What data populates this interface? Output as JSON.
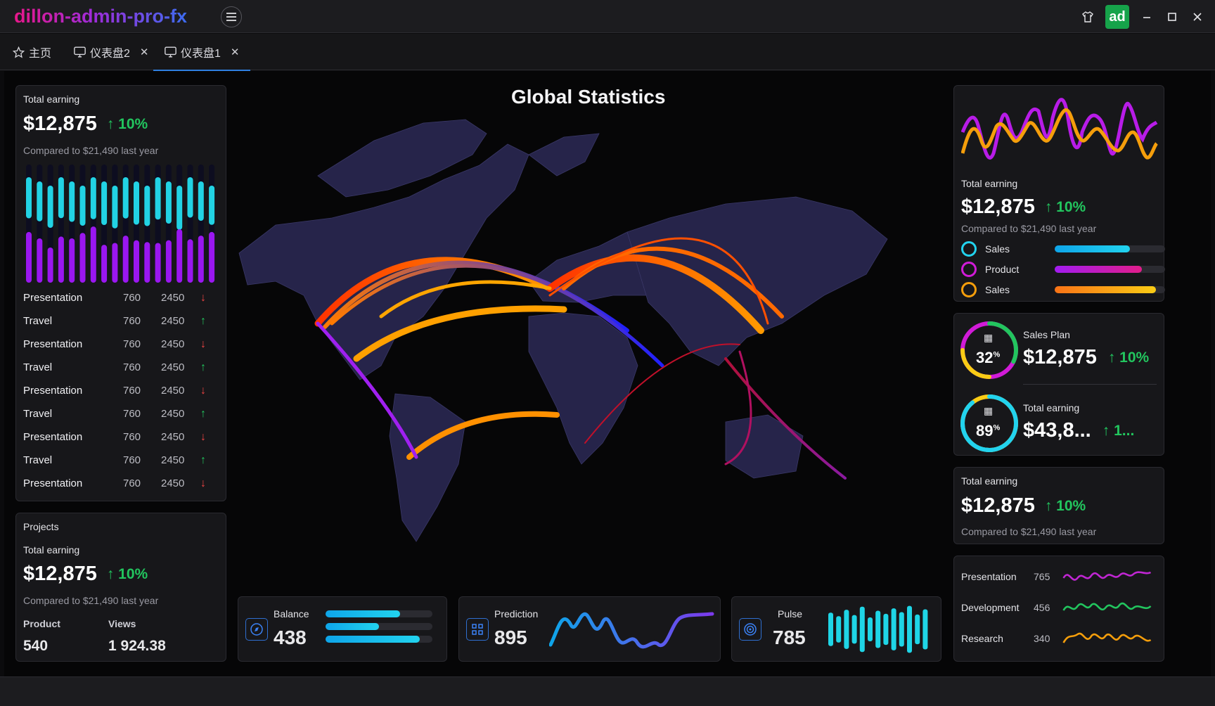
{
  "app": {
    "title": "dillon-admin-pro-fx",
    "avatar": "ad"
  },
  "tabs": [
    {
      "label": "主页",
      "icon": "star-icon",
      "closable": false
    },
    {
      "label": "仪表盘2",
      "icon": "monitor-icon",
      "closable": true
    },
    {
      "label": "仪表盘1",
      "icon": "monitor-icon",
      "closable": true,
      "active": true
    }
  ],
  "colors": {
    "accent": "#2f7fe0",
    "up": "#22c55e",
    "down": "#ef4444",
    "cyan": "#22d3ee",
    "purple": "#a21cf0",
    "orange": "#f59e0b",
    "magenta": "#d11bd8"
  },
  "earning_card": {
    "title": "Total earning",
    "amount": "$12,875",
    "pct": "10%",
    "compare": "Compared to $21,490 last year",
    "bars": [
      {
        "top": 0.74,
        "bottom": 0.57
      },
      {
        "top": 0.67,
        "bottom": 0.5
      },
      {
        "top": 0.8,
        "bottom": 0.4
      },
      {
        "top": 0.73,
        "bottom": 0.52
      },
      {
        "top": 0.7,
        "bottom": 0.5
      },
      {
        "top": 0.68,
        "bottom": 0.56
      },
      {
        "top": 0.79,
        "bottom": 0.63
      },
      {
        "top": 0.88,
        "bottom": 0.43
      },
      {
        "top": 0.83,
        "bottom": 0.45
      },
      {
        "top": 0.75,
        "bottom": 0.53
      },
      {
        "top": 0.86,
        "bottom": 0.48
      },
      {
        "top": 0.7,
        "bottom": 0.46
      },
      {
        "top": 0.81,
        "bottom": 0.45
      },
      {
        "top": 0.8,
        "bottom": 0.48
      },
      {
        "top": 0.91,
        "bottom": 0.6
      },
      {
        "top": 0.7,
        "bottom": 0.49
      },
      {
        "top": 0.64,
        "bottom": 0.53
      },
      {
        "top": 0.63,
        "bottom": 0.57
      }
    ]
  },
  "list": [
    {
      "name": "Presentation",
      "v1": "760",
      "v2": "2450",
      "dir": "down"
    },
    {
      "name": "Travel",
      "v1": "760",
      "v2": "2450",
      "dir": "up"
    },
    {
      "name": "Presentation",
      "v1": "760",
      "v2": "2450",
      "dir": "down"
    },
    {
      "name": "Travel",
      "v1": "760",
      "v2": "2450",
      "dir": "up"
    },
    {
      "name": "Presentation",
      "v1": "760",
      "v2": "2450",
      "dir": "down"
    },
    {
      "name": "Travel",
      "v1": "760",
      "v2": "2450",
      "dir": "up"
    },
    {
      "name": "Presentation",
      "v1": "760",
      "v2": "2450",
      "dir": "down"
    },
    {
      "name": "Travel",
      "v1": "760",
      "v2": "2450",
      "dir": "up"
    },
    {
      "name": "Presentation",
      "v1": "760",
      "v2": "2450",
      "dir": "down"
    }
  ],
  "projects": {
    "title": "Projects",
    "subtitle": "Total earning",
    "amount": "$12,875",
    "pct": "10%",
    "compare": "Compared to $21,490 last year",
    "col1_label": "Product",
    "col1_value": "540",
    "col2_label": "Views",
    "col2_value": "1 924.38"
  },
  "map": {
    "title": "Global Statistics"
  },
  "mini": {
    "balance": {
      "label": "Balance",
      "value": "438",
      "icon": "compass-icon",
      "bars": [
        0.7,
        0.5,
        0.88
      ]
    },
    "prediction": {
      "label": "Prediction",
      "value": "895",
      "icon": "grid-icon"
    },
    "pulse": {
      "label": "Pulse",
      "value": "785",
      "icon": "target-icon",
      "bars": [
        0.7,
        0.55,
        0.82,
        0.6,
        0.95,
        0.5,
        0.78,
        0.65,
        0.88,
        0.72,
        0.98,
        0.62,
        0.84
      ]
    }
  },
  "right_top": {
    "title": "Total earning",
    "amount": "$12,875",
    "pct": "10%",
    "compare": "Compared to $21,490 last year",
    "legend": [
      {
        "label": "Sales",
        "ring": "#22d3ee",
        "fill": 0.68,
        "grad": "#0ea5e9,#22d3ee"
      },
      {
        "label": "Product",
        "ring": "#d11bd8",
        "fill": 0.79,
        "grad": "#a21cf0,#e11d8a"
      },
      {
        "label": "Sales",
        "ring": "#f59e0b",
        "fill": 0.92,
        "grad": "#f97316,#facc15"
      }
    ]
  },
  "gauges": [
    {
      "pct_value": "32",
      "pct_sign": "%",
      "label": "Sales Plan",
      "amount": "$12,875",
      "pct": "10%",
      "fill": 0.32
    },
    {
      "pct_value": "89",
      "pct_sign": "%",
      "label": "Total earning",
      "amount": "$43,8...",
      "pct": "1...",
      "fill": 0.89
    }
  ],
  "right_earning": {
    "title": "Total earning",
    "amount": "$12,875",
    "pct": "10%",
    "compare": "Compared to $21,490 last year"
  },
  "sparks": [
    {
      "label": "Presentation",
      "value": "765",
      "color": "#c026d3"
    },
    {
      "label": "Development",
      "value": "456",
      "color": "#22c55e"
    },
    {
      "label": "Research",
      "value": "340",
      "color": "#f59e0b"
    }
  ]
}
